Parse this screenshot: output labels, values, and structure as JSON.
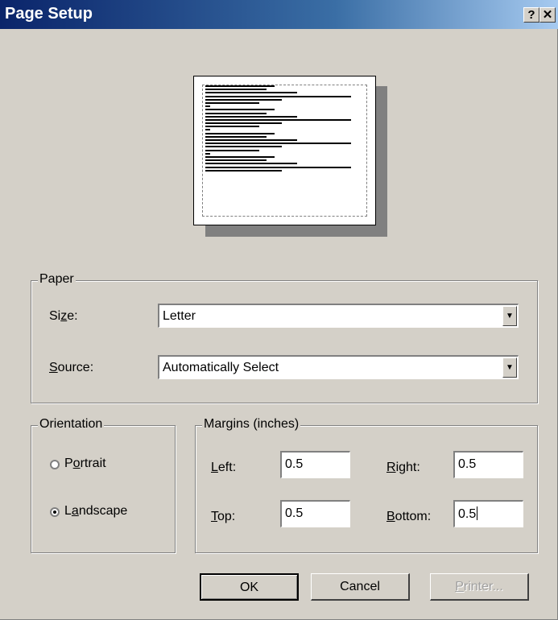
{
  "window": {
    "title": "Page Setup",
    "help_glyph": "?",
    "close_glyph": "✕"
  },
  "paper": {
    "legend": "Paper",
    "size_label": "Size:",
    "size_value": "Letter",
    "source_label": "Source:",
    "source_value": "Automatically Select"
  },
  "orientation": {
    "legend": "Orientation",
    "portrait_label": "Portrait",
    "landscape_label": "Landscape",
    "selected": "Landscape"
  },
  "margins": {
    "legend": "Margins (inches)",
    "left_label": "Left:",
    "left_value": "0.5",
    "right_label": "Right:",
    "right_value": "0.5",
    "top_label": "Top:",
    "top_value": "0.5",
    "bottom_label": "Bottom:",
    "bottom_value": "0.5"
  },
  "buttons": {
    "ok": "OK",
    "cancel": "Cancel",
    "printer": "Printer..."
  },
  "icons": {
    "dropdown_arrow": "▼"
  },
  "colors": {
    "titlebar_start": "#0a246a",
    "titlebar_end": "#a6caf0",
    "dialog_face": "#d4d0c8"
  }
}
